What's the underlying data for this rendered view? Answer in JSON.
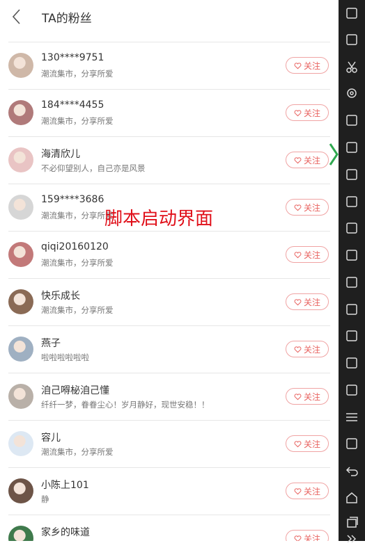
{
  "header": {
    "back_icon": "back-chevron-icon",
    "title": "TA的粉丝"
  },
  "follow_label": "关注",
  "follow_icon": "heart-outline-icon",
  "overlay_text": "脚本启动界面",
  "colors": {
    "accent": "#e8625f",
    "follow_border": "#f0a3a3",
    "overlay": "#e0101a",
    "sidebar_bg": "#1f1f1f"
  },
  "fans": [
    {
      "name": "130****9751",
      "signature": "潮流集市，分享所爱"
    },
    {
      "name": "184****4455",
      "signature": "潮流集市，分享所爱"
    },
    {
      "name": "海清欣儿",
      "signature": "不必仰望别人，自己亦是风景"
    },
    {
      "name": "159****3686",
      "signature": "潮流集市，分享所爱"
    },
    {
      "name": "qiqi20160120",
      "signature": "潮流集市，分享所爱"
    },
    {
      "name": "快乐成长",
      "signature": "潮流集市，分享所爱"
    },
    {
      "name": "燕子",
      "signature": "啦啦啦啦啦啦"
    },
    {
      "name": "洎己嘚柲洎己懂",
      "signature": "纤纤一梦，眷眷尘心！岁月静好，现世安稳！！"
    },
    {
      "name": "容儿",
      "signature": "潮流集市，分享所爱"
    },
    {
      "name": "小陈上101",
      "signature": "静"
    },
    {
      "name": "家乡的味道",
      "signature": ""
    }
  ],
  "sidebar": {
    "icons": [
      "vibrate-icon",
      "keyboard-icon",
      "scissors-icon",
      "location-icon",
      "screen-icon",
      "fullscreen-icon",
      "volume-up-icon",
      "volume-down-icon",
      "apk-install-icon",
      "loading-icon",
      "shake-icon",
      "camera-icon",
      "toolbox-icon",
      "gamepad-icon",
      "link-icon",
      "menu-icon",
      "add-icon",
      "back-icon",
      "home-icon",
      "recents-icon",
      "more-icon"
    ]
  }
}
